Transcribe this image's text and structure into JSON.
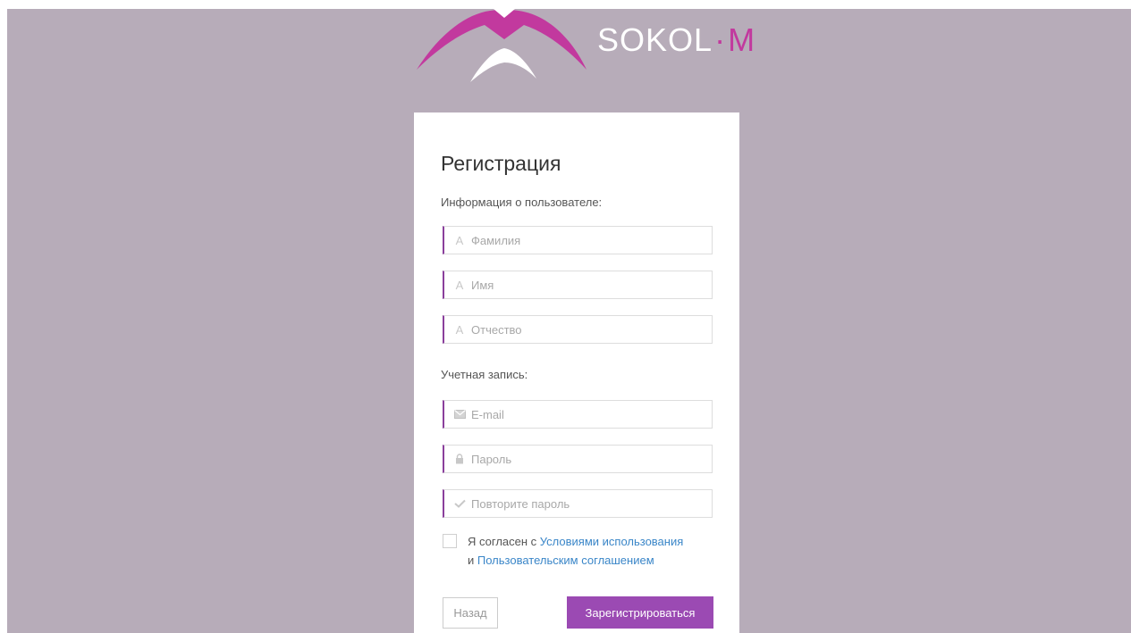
{
  "brand": {
    "name": "SOKOL",
    "separator": "·",
    "suffix": "M"
  },
  "form": {
    "title": "Регистрация",
    "user_section_label": "Информация о пользователе:",
    "last_name": {
      "placeholder": "Фамилия",
      "value": "",
      "icon": "person-icon"
    },
    "first_name": {
      "placeholder": "Имя",
      "value": "",
      "icon": "person-icon"
    },
    "middle_name": {
      "placeholder": "Отчество",
      "value": "",
      "icon": "person-icon"
    },
    "account_section_label": "Учетная запись:",
    "email": {
      "placeholder": "E-mail",
      "value": "",
      "icon": "envelope-icon"
    },
    "password": {
      "placeholder": "Пароль",
      "value": "",
      "icon": "lock-icon"
    },
    "password_repeat": {
      "placeholder": "Повторите пароль",
      "value": "",
      "icon": "checkmark-icon"
    },
    "agree": {
      "checked": false,
      "text_prefix": "Я согласен с ",
      "terms_link": "Условиями использования",
      "text_and": " и ",
      "agreement_link": "Пользовательским соглашением"
    },
    "back_button": "Назад",
    "register_button": "Зарегистрироваться"
  },
  "colors": {
    "background": "#b7acb9",
    "accent": "#9b4ab3",
    "brand_pink": "#c2399e",
    "link": "#3a86c8"
  }
}
